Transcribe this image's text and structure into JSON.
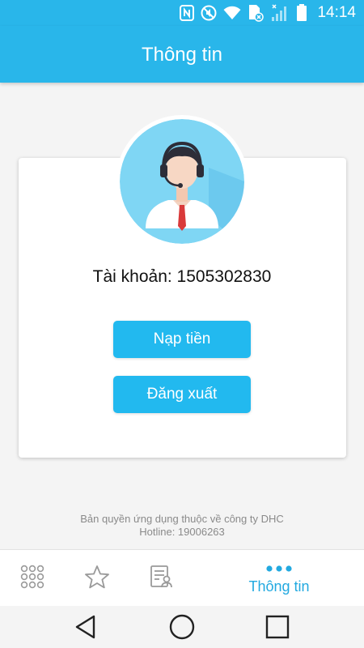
{
  "status_bar": {
    "time": "14:14",
    "icons": [
      "nfc-icon",
      "mute-icon",
      "wifi-icon",
      "sim-icon",
      "signal-icon",
      "battery-icon"
    ]
  },
  "app_bar": {
    "title": "Thông tin"
  },
  "profile": {
    "avatar": "support-agent-avatar",
    "account_text": "Tài khoản: 1505302830"
  },
  "actions": {
    "topup_label": "Nạp tiền",
    "logout_label": "Đăng xuất"
  },
  "footer": {
    "copyright": "Bản quyền ứng dụng thuộc về công ty DHC",
    "hotline": "Hotline: 19006263"
  },
  "bottom_nav": {
    "items": [
      {
        "icon": "grid-icon",
        "label": ""
      },
      {
        "icon": "star-icon",
        "label": ""
      },
      {
        "icon": "contact-list-icon",
        "label": ""
      },
      {
        "icon": "more-dots-icon",
        "label": "Thông tin",
        "active": true
      }
    ]
  },
  "colors": {
    "primary": "#29b6ea",
    "button": "#22b9ef",
    "active_tab": "#22a9e0"
  }
}
